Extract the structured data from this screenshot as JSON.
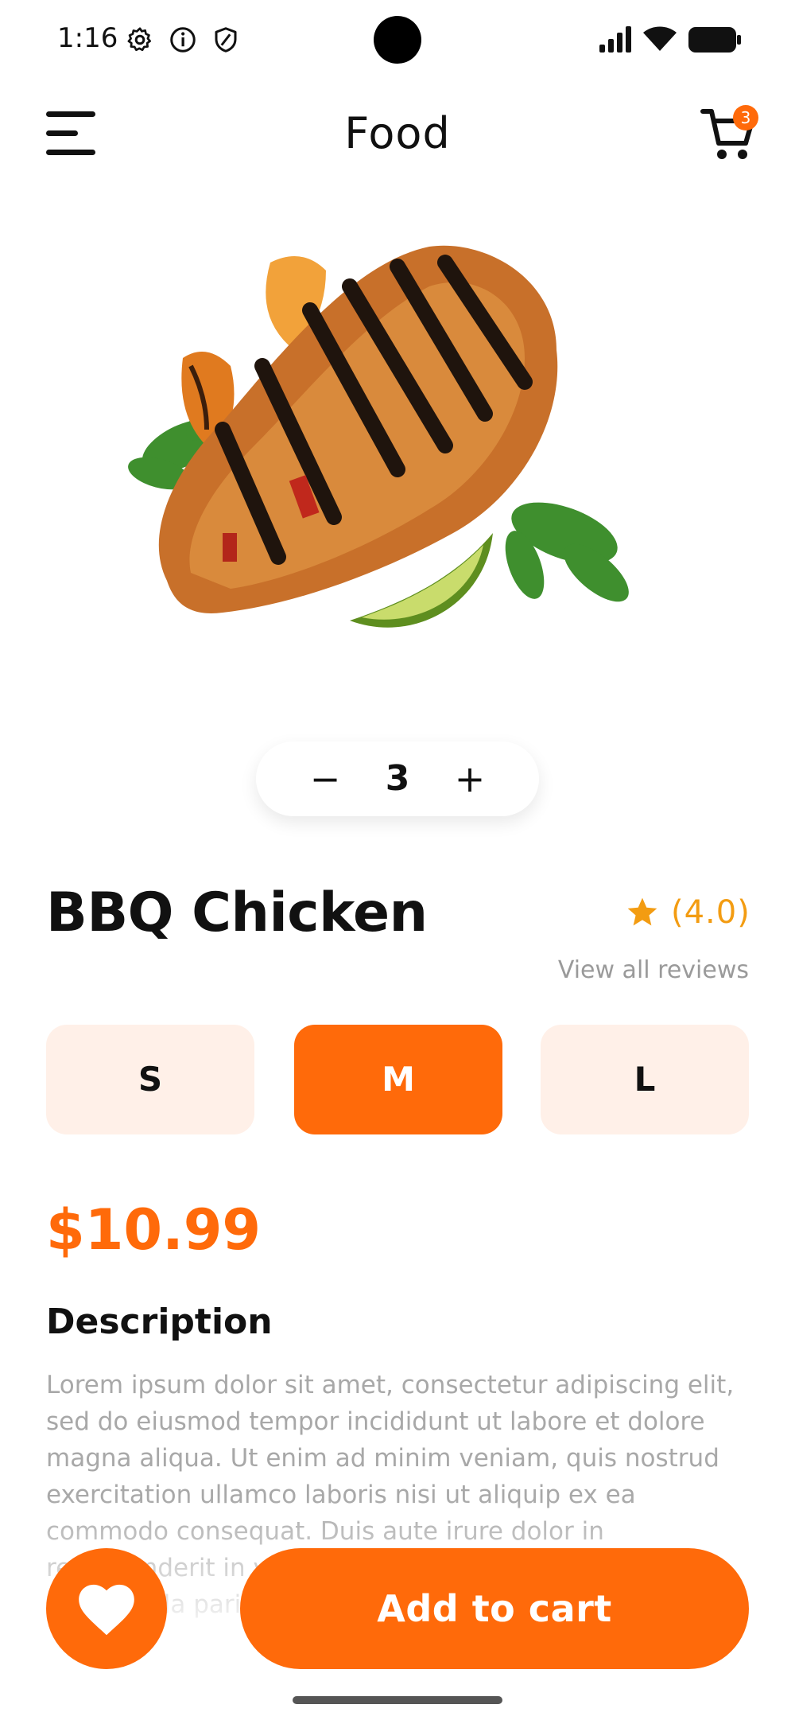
{
  "status_bar": {
    "time": "1:16",
    "icons": [
      "settings-icon",
      "info-icon",
      "shield-icon",
      "signal-icon",
      "wifi-icon",
      "battery-icon"
    ]
  },
  "header": {
    "title": "Food",
    "cart_count": "3"
  },
  "product": {
    "image": "bbq-chicken-image",
    "quantity": "3",
    "name": "BBQ Chicken",
    "rating": "(4.0)",
    "view_reviews": "View all reviews",
    "sizes": [
      {
        "label": "S",
        "selected": false
      },
      {
        "label": "M",
        "selected": true
      },
      {
        "label": "L",
        "selected": false
      }
    ],
    "price": "$10.99",
    "description_heading": "Description",
    "description": "Lorem ipsum dolor sit amet, consectetur adipiscing elit, sed do eiusmod tempor incididunt ut labore et dolore magna aliqua. Ut enim ad minim veniam, quis nostrud exercitation ullamco laboris nisi ut aliquip ex ea commodo consequat. Duis aute irure dolor in reprehenderit in voluptate velit esse cillum dolore eu fugiat nulla pariatur. Excepteur sint"
  },
  "actions": {
    "add_to_cart": "Add to cart"
  },
  "colors": {
    "accent": "#ff6a0a",
    "size_bg": "#fff0e8",
    "star": "#f39c12",
    "muted_text": "#a8a8a8"
  }
}
